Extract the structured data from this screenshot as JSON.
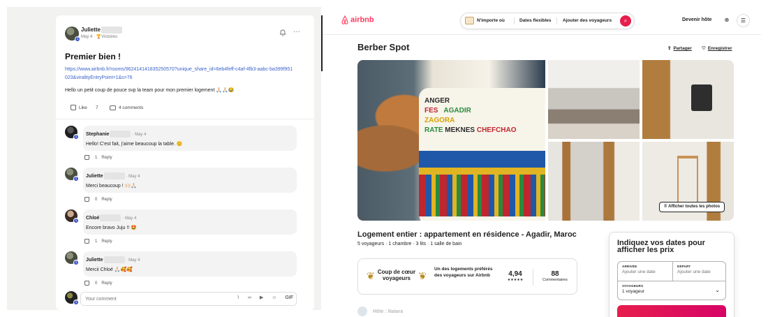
{
  "post": {
    "author": "Juliette",
    "date": "May 4",
    "badge": "Victoires",
    "title": "Premier bien !",
    "link": "https://www.airbnb.fr/rooms/962414141835250570?unique_share_id=6eb4feff-c4af-4fb3-aabc-ba399f951023&viralityEntryPoint=1&s=76",
    "body": "Hello un petit coup de pouce svp la team pour mon premier logement 🙏🏻🙏🏻😂",
    "like_label": "Like",
    "like_count": "7",
    "comments_label": "4 comments"
  },
  "comments": [
    {
      "name": "Stephanie",
      "date": "· May 4",
      "text": "Hello! C'est fait, j'aime beaucoup la table. 😊",
      "likes": "1",
      "reply": "Reply"
    },
    {
      "name": "Juliette",
      "date": "· May 4",
      "text": "Merci beaucoup ! 🙌🏻🙏🏻",
      "likes": "0",
      "reply": "Reply"
    },
    {
      "name": "Chloé",
      "date": "· May 4",
      "text": "Encore bravo Juju !! 🤩",
      "likes": "1",
      "reply": "Reply"
    },
    {
      "name": "Juliette",
      "date": "· May 4",
      "text": "Mercii Chloé 🙏🏻🥰🥰",
      "likes": "0",
      "reply": "Reply"
    }
  ],
  "compose": {
    "placeholder": "Your comment",
    "gif_label": "GIF"
  },
  "airbnb": {
    "logo": "airbnb",
    "search": {
      "where": "N'importe où",
      "dates": "Dates flexibles",
      "guests": "Ajouter des voyageurs"
    },
    "host_link": "Devenir hôte",
    "listing_title": "Berber Spot",
    "share": "Partager",
    "save": "Enregistrer",
    "show_all_photos": "Afficher toutes les photos",
    "cup_words": [
      "ANGER",
      "FES",
      "AGADIR",
      "ZAGORA",
      "RATE",
      "MEKNES",
      "CHEFCHAO"
    ],
    "subtitle": "Logement entier : appartement en résidence - Agadir, Maroc",
    "specs": "5 voyageurs · 1 chambre · 3 lits · 1 salle de bain",
    "favorite_title": "Coup de cœur voyageurs",
    "favorite_desc": "Un des logements préférés des voyageurs sur Airbnb",
    "rating": "4,94",
    "stars": "★★★★★",
    "reviews": "88",
    "reviews_label": "Commentaires",
    "host_name": "Hôte : Naiara",
    "booking": {
      "title": "Indiquez vos dates pour afficher les prix",
      "arrival_label": "ARRIVÉE",
      "arrival_value": "Ajouter une date",
      "departure_label": "DÉPART",
      "departure_value": "Ajouter une date",
      "guests_label": "VOYAGEURS",
      "guests_value": "1 voyageur"
    }
  },
  "colors": {
    "brand": "#ff385c",
    "link": "#3a63c9",
    "badge": "#3a55c8"
  }
}
